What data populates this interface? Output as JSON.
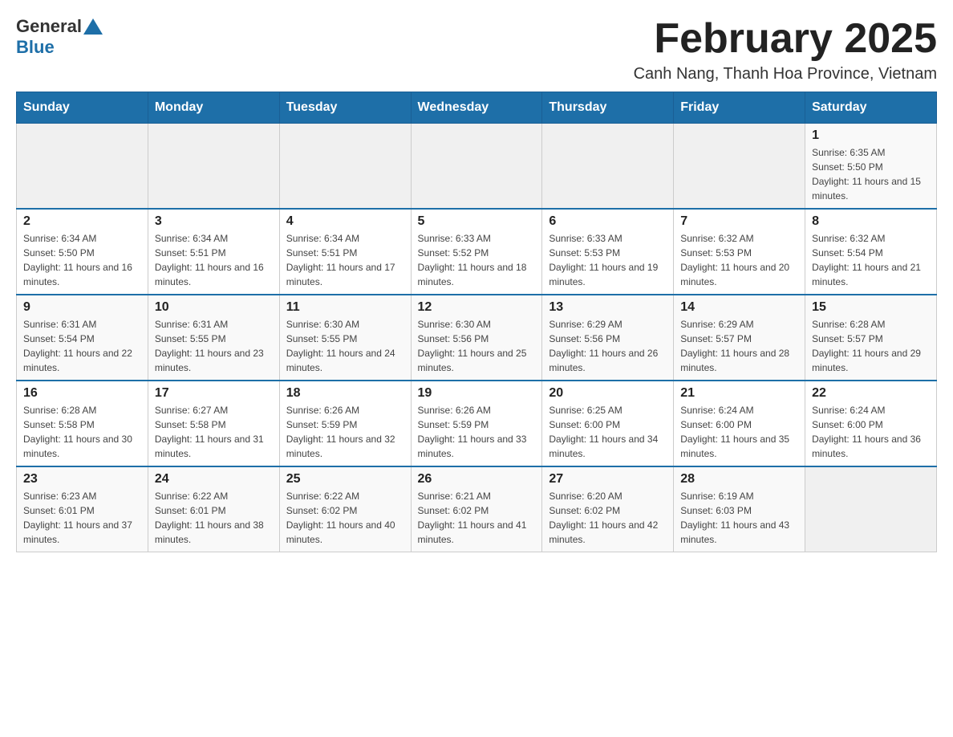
{
  "header": {
    "logo_general": "General",
    "logo_blue": "Blue",
    "month_title": "February 2025",
    "location": "Canh Nang, Thanh Hoa Province, Vietnam"
  },
  "days_of_week": [
    "Sunday",
    "Monday",
    "Tuesday",
    "Wednesday",
    "Thursday",
    "Friday",
    "Saturday"
  ],
  "weeks": [
    {
      "days": [
        {
          "num": "",
          "info": ""
        },
        {
          "num": "",
          "info": ""
        },
        {
          "num": "",
          "info": ""
        },
        {
          "num": "",
          "info": ""
        },
        {
          "num": "",
          "info": ""
        },
        {
          "num": "",
          "info": ""
        },
        {
          "num": "1",
          "info": "Sunrise: 6:35 AM\nSunset: 5:50 PM\nDaylight: 11 hours and 15 minutes."
        }
      ]
    },
    {
      "days": [
        {
          "num": "2",
          "info": "Sunrise: 6:34 AM\nSunset: 5:50 PM\nDaylight: 11 hours and 16 minutes."
        },
        {
          "num": "3",
          "info": "Sunrise: 6:34 AM\nSunset: 5:51 PM\nDaylight: 11 hours and 16 minutes."
        },
        {
          "num": "4",
          "info": "Sunrise: 6:34 AM\nSunset: 5:51 PM\nDaylight: 11 hours and 17 minutes."
        },
        {
          "num": "5",
          "info": "Sunrise: 6:33 AM\nSunset: 5:52 PM\nDaylight: 11 hours and 18 minutes."
        },
        {
          "num": "6",
          "info": "Sunrise: 6:33 AM\nSunset: 5:53 PM\nDaylight: 11 hours and 19 minutes."
        },
        {
          "num": "7",
          "info": "Sunrise: 6:32 AM\nSunset: 5:53 PM\nDaylight: 11 hours and 20 minutes."
        },
        {
          "num": "8",
          "info": "Sunrise: 6:32 AM\nSunset: 5:54 PM\nDaylight: 11 hours and 21 minutes."
        }
      ]
    },
    {
      "days": [
        {
          "num": "9",
          "info": "Sunrise: 6:31 AM\nSunset: 5:54 PM\nDaylight: 11 hours and 22 minutes."
        },
        {
          "num": "10",
          "info": "Sunrise: 6:31 AM\nSunset: 5:55 PM\nDaylight: 11 hours and 23 minutes."
        },
        {
          "num": "11",
          "info": "Sunrise: 6:30 AM\nSunset: 5:55 PM\nDaylight: 11 hours and 24 minutes."
        },
        {
          "num": "12",
          "info": "Sunrise: 6:30 AM\nSunset: 5:56 PM\nDaylight: 11 hours and 25 minutes."
        },
        {
          "num": "13",
          "info": "Sunrise: 6:29 AM\nSunset: 5:56 PM\nDaylight: 11 hours and 26 minutes."
        },
        {
          "num": "14",
          "info": "Sunrise: 6:29 AM\nSunset: 5:57 PM\nDaylight: 11 hours and 28 minutes."
        },
        {
          "num": "15",
          "info": "Sunrise: 6:28 AM\nSunset: 5:57 PM\nDaylight: 11 hours and 29 minutes."
        }
      ]
    },
    {
      "days": [
        {
          "num": "16",
          "info": "Sunrise: 6:28 AM\nSunset: 5:58 PM\nDaylight: 11 hours and 30 minutes."
        },
        {
          "num": "17",
          "info": "Sunrise: 6:27 AM\nSunset: 5:58 PM\nDaylight: 11 hours and 31 minutes."
        },
        {
          "num": "18",
          "info": "Sunrise: 6:26 AM\nSunset: 5:59 PM\nDaylight: 11 hours and 32 minutes."
        },
        {
          "num": "19",
          "info": "Sunrise: 6:26 AM\nSunset: 5:59 PM\nDaylight: 11 hours and 33 minutes."
        },
        {
          "num": "20",
          "info": "Sunrise: 6:25 AM\nSunset: 6:00 PM\nDaylight: 11 hours and 34 minutes."
        },
        {
          "num": "21",
          "info": "Sunrise: 6:24 AM\nSunset: 6:00 PM\nDaylight: 11 hours and 35 minutes."
        },
        {
          "num": "22",
          "info": "Sunrise: 6:24 AM\nSunset: 6:00 PM\nDaylight: 11 hours and 36 minutes."
        }
      ]
    },
    {
      "days": [
        {
          "num": "23",
          "info": "Sunrise: 6:23 AM\nSunset: 6:01 PM\nDaylight: 11 hours and 37 minutes."
        },
        {
          "num": "24",
          "info": "Sunrise: 6:22 AM\nSunset: 6:01 PM\nDaylight: 11 hours and 38 minutes."
        },
        {
          "num": "25",
          "info": "Sunrise: 6:22 AM\nSunset: 6:02 PM\nDaylight: 11 hours and 40 minutes."
        },
        {
          "num": "26",
          "info": "Sunrise: 6:21 AM\nSunset: 6:02 PM\nDaylight: 11 hours and 41 minutes."
        },
        {
          "num": "27",
          "info": "Sunrise: 6:20 AM\nSunset: 6:02 PM\nDaylight: 11 hours and 42 minutes."
        },
        {
          "num": "28",
          "info": "Sunrise: 6:19 AM\nSunset: 6:03 PM\nDaylight: 11 hours and 43 minutes."
        },
        {
          "num": "",
          "info": ""
        }
      ]
    }
  ]
}
